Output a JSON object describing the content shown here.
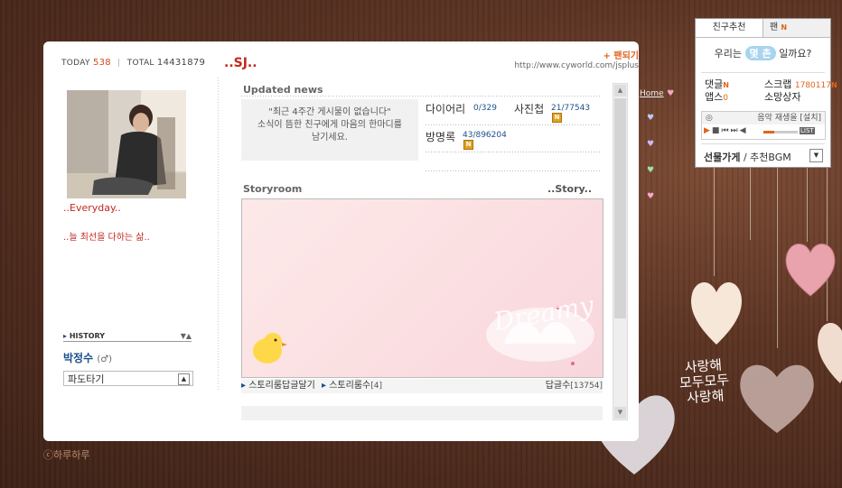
{
  "profile": {
    "today_label": "TODAY",
    "today_count": "538",
    "total_label": "TOTAL",
    "total_count": "14431879",
    "mood": "..Everyday..",
    "mood_text": "..늘 최선을 다하는 삶..",
    "history_label": "HISTORY",
    "name": "박정수",
    "gender": "(♂)",
    "pado_label": "파도타기"
  },
  "header": {
    "title": "..SJ..",
    "fan_label": "+ 팬되기",
    "url": "http://www.cyworld.com/jsplus"
  },
  "news": {
    "title": "Updated news",
    "empty_msg": "\"최근 4주간 게시물이 없습니다\"",
    "empty_sub": "소식이 뜸한 친구에게 마음의 한마디를",
    "empty_sub2": "남기세요.",
    "diary_label": "다이어리",
    "diary_value": "0/329",
    "photo_label": "사진첩",
    "photo_value": "21/77543",
    "guestbook_label": "방명록",
    "guestbook_value": "43/896204",
    "new_badge": "N"
  },
  "storyroom": {
    "title": "Storyroom",
    "link": "..Story..",
    "decor_text": "Dreamy",
    "reply_link": "스토리룸답글달기",
    "count_label": "스토리룸수",
    "count_value": "[4]",
    "reply_count_label": "답글수",
    "reply_count_value": "[13754]"
  },
  "menu": {
    "home": "Home"
  },
  "panel": {
    "tab_recommend": "친구추천",
    "tab_fan": "팬",
    "tab_fan_badge": "N",
    "chon_prefix": "우리는",
    "chon_pill": "몇 촌",
    "chon_suffix": "일까요?",
    "comment_label": "댓글",
    "comment_badge": "N",
    "scrap_label": "스크랩",
    "scrap_count": "1780117",
    "scrap_badge": "N",
    "app_label": "앱스",
    "app_count": "0",
    "wish_label": "소망상자",
    "music_text": "음악 재생을 [설치]",
    "list_label": "LIST",
    "gift_label": "선물가게",
    "gift_sub": " / 추천BGM"
  },
  "wall": {
    "text1": "사랑해",
    "text2": "모두모두",
    "text3": "사랑해"
  },
  "copyright": "ⓒ하루하루",
  "colors": {
    "accent": "#c2281d",
    "link": "#1c4f8a",
    "orange": "#e0641e",
    "background": "#4a2a1c"
  }
}
